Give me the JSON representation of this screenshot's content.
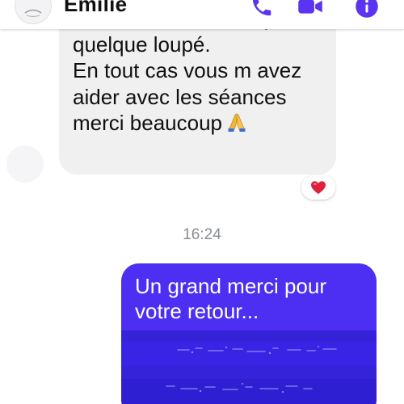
{
  "header": {
    "contact_name": "Emilie",
    "avatar_icon": "user-avatar",
    "call_icon": "phone-icon",
    "video_icon": "video-camera-icon",
    "info_icon": "info-icon",
    "accent_color": "#5b34f2"
  },
  "conversation": {
    "received_message": {
      "text": "accroche même si il y a\nquelque loupé.\nEn tout cas vous m avez\naider avec les séances\nmerci beaucoup",
      "emoji": "folded-hands-emoji",
      "bubble_color": "#f0f0f1",
      "reaction": {
        "emoji": "heart-emoji",
        "color": "#e01f3d"
      }
    },
    "timestamp": "16:24",
    "sent_message": {
      "text": "Un grand merci pour\nvotre retour...",
      "bubble_color": "#4c2ff3",
      "text_color": "#ffffff"
    }
  }
}
